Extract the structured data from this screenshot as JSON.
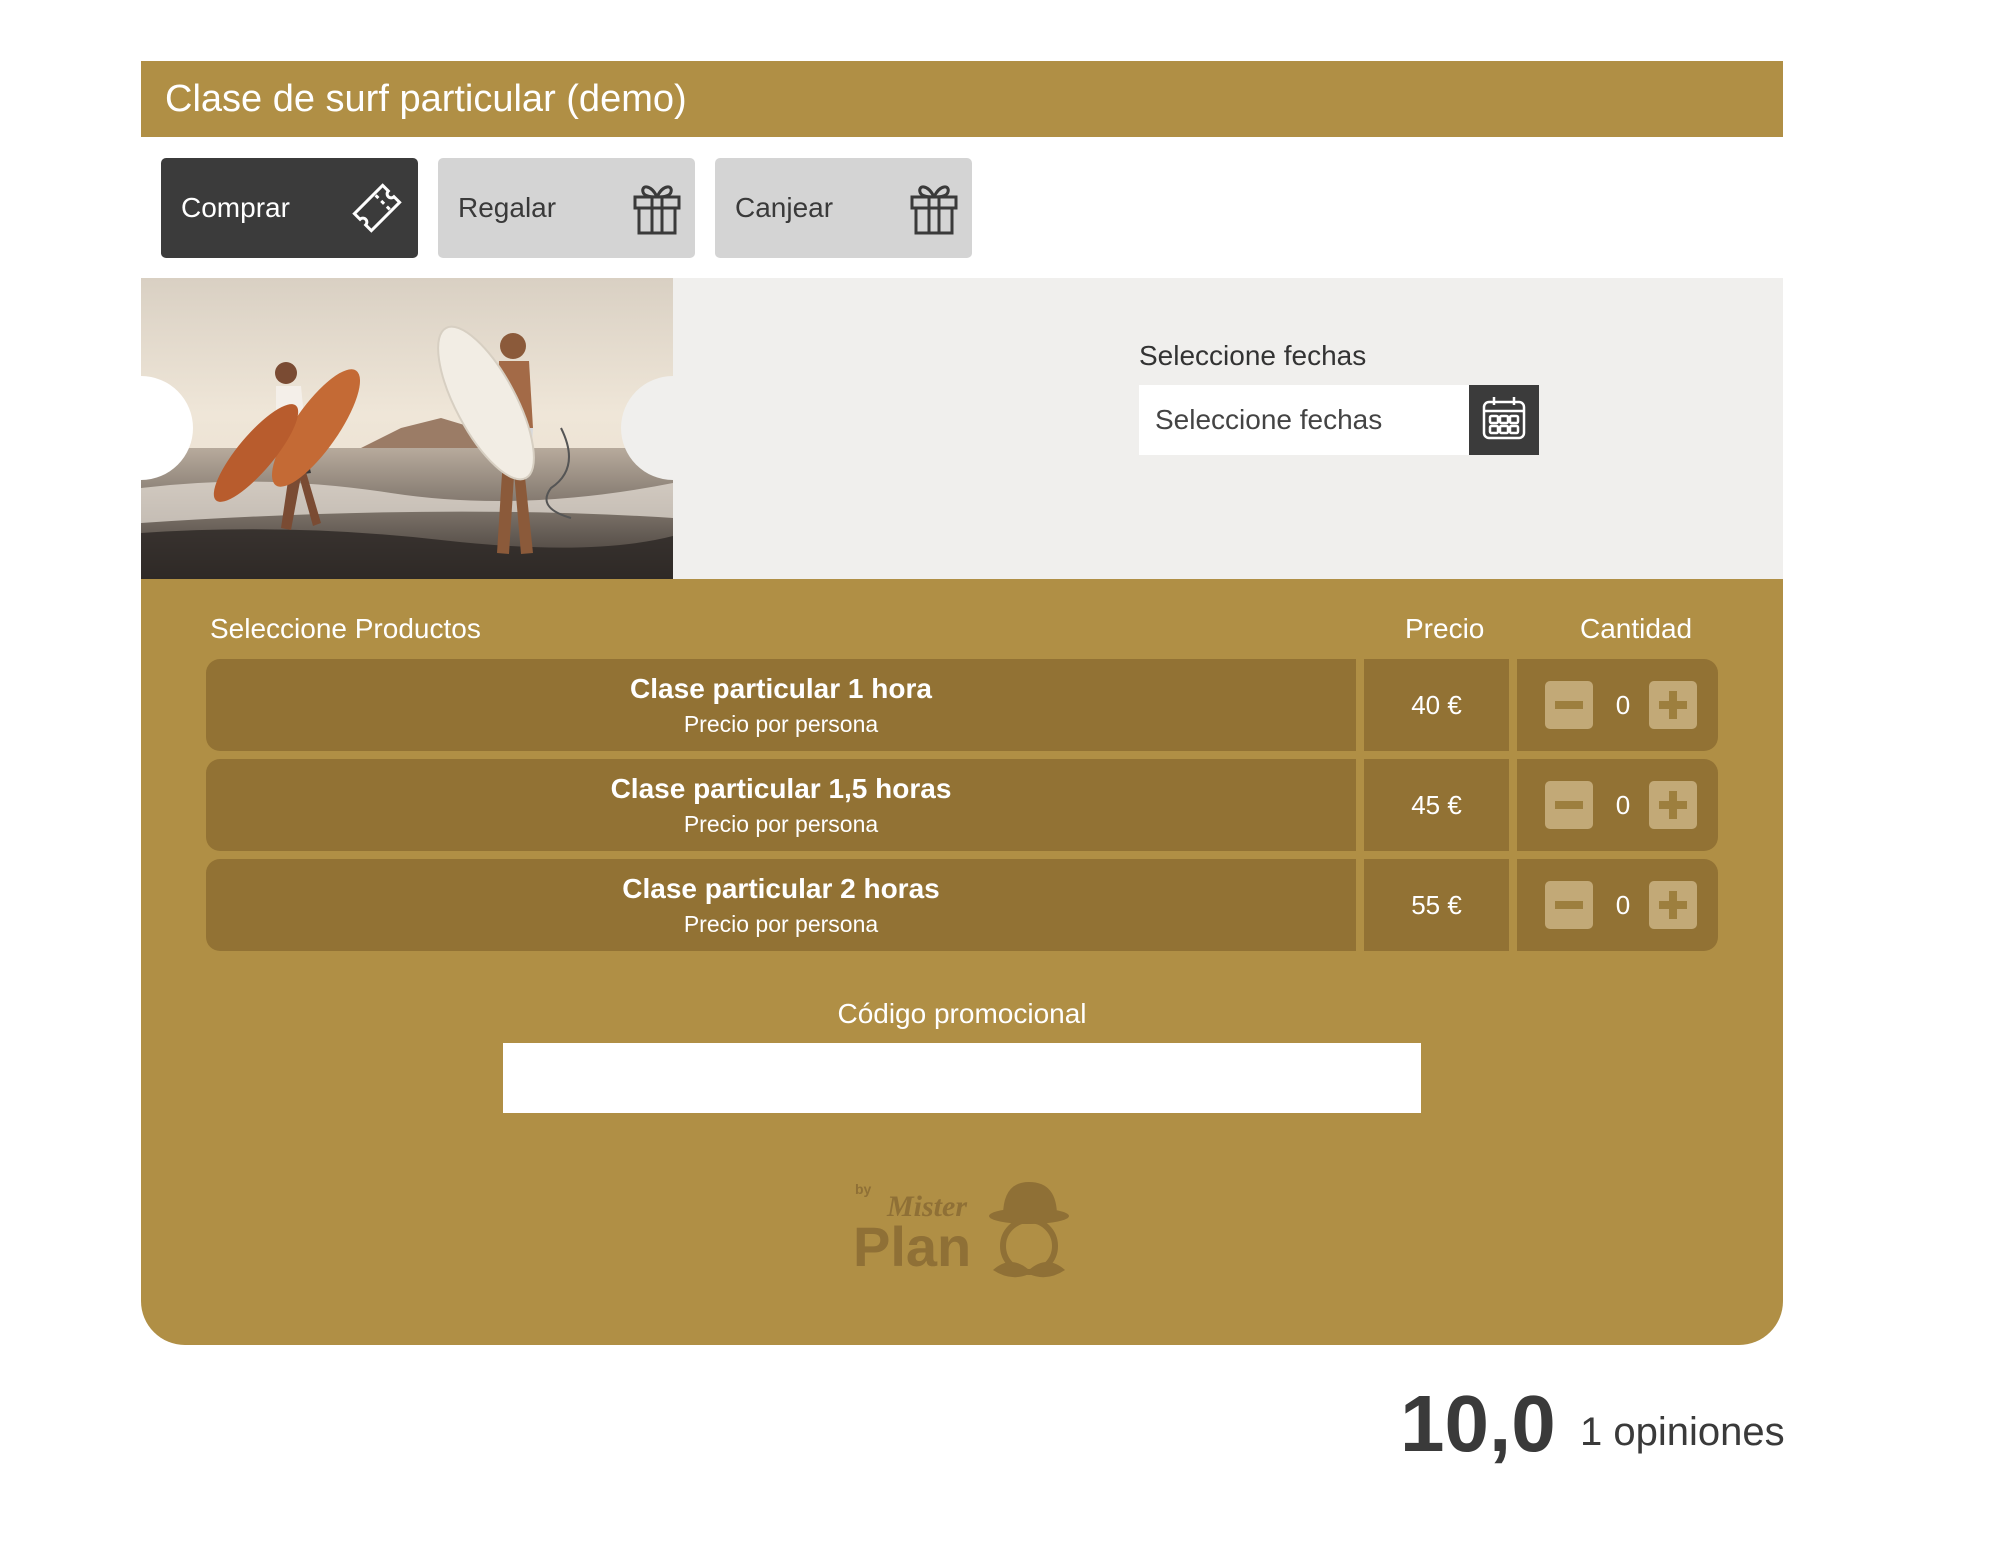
{
  "header": {
    "title": "Clase de surf particular (demo)"
  },
  "tabs": [
    {
      "label": "Comprar",
      "icon": "ticket-icon",
      "active": true
    },
    {
      "label": "Regalar",
      "icon": "gift-icon",
      "active": false
    },
    {
      "label": "Canjear",
      "icon": "gift-icon",
      "active": false
    }
  ],
  "dates": {
    "label": "Seleccione fechas",
    "placeholder": "Seleccione fechas",
    "icon": "calendar-icon"
  },
  "products": {
    "heading": "Seleccione Productos",
    "price_heading": "Precio",
    "qty_heading": "Cantidad",
    "items": [
      {
        "name": "Clase particular 1 hora",
        "sub": "Precio por persona",
        "price": "40 €",
        "qty": "0"
      },
      {
        "name": "Clase particular 1,5 horas",
        "sub": "Precio por persona",
        "price": "45 €",
        "qty": "0"
      },
      {
        "name": "Clase particular 2 horas",
        "sub": "Precio por persona",
        "price": "55 €",
        "qty": "0"
      }
    ]
  },
  "promo": {
    "label": "Código promocional",
    "value": ""
  },
  "logo": {
    "by": "by",
    "top": "Mister",
    "bottom": "Plan"
  },
  "rating": {
    "score": "10,0",
    "count": "1 opiniones"
  },
  "colors": {
    "brand": "#b08f45",
    "row": "#927234",
    "dark": "#3b3b3b",
    "tab_inactive": "#d4d4d4",
    "hero_bg": "#f0efed"
  }
}
